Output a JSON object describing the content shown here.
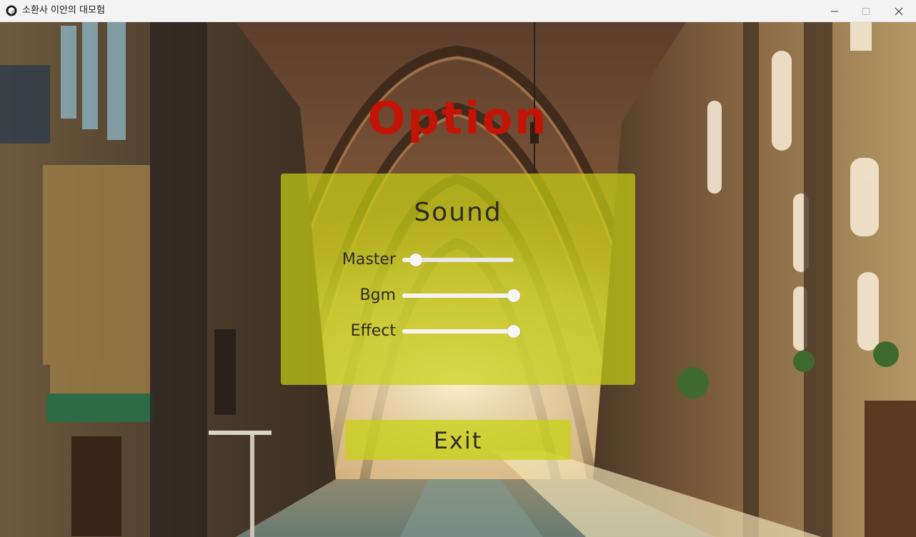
{
  "window": {
    "title": "소환사 이안의 대모험",
    "app_icon": "unity-icon",
    "controls": [
      "minimize-icon",
      "maximize-icon",
      "close-icon"
    ]
  },
  "scene": {
    "background": "cathedral-corridor-illustration",
    "title": "Option",
    "title_color": "#c41406",
    "panel_color": "#c8d214"
  },
  "sound": {
    "heading": "Sound",
    "sliders": [
      {
        "label": "Master",
        "value": 0.12
      },
      {
        "label": "Bgm",
        "value": 1.0
      },
      {
        "label": "Effect",
        "value": 1.0
      }
    ]
  },
  "exit": {
    "label": "Exit"
  }
}
